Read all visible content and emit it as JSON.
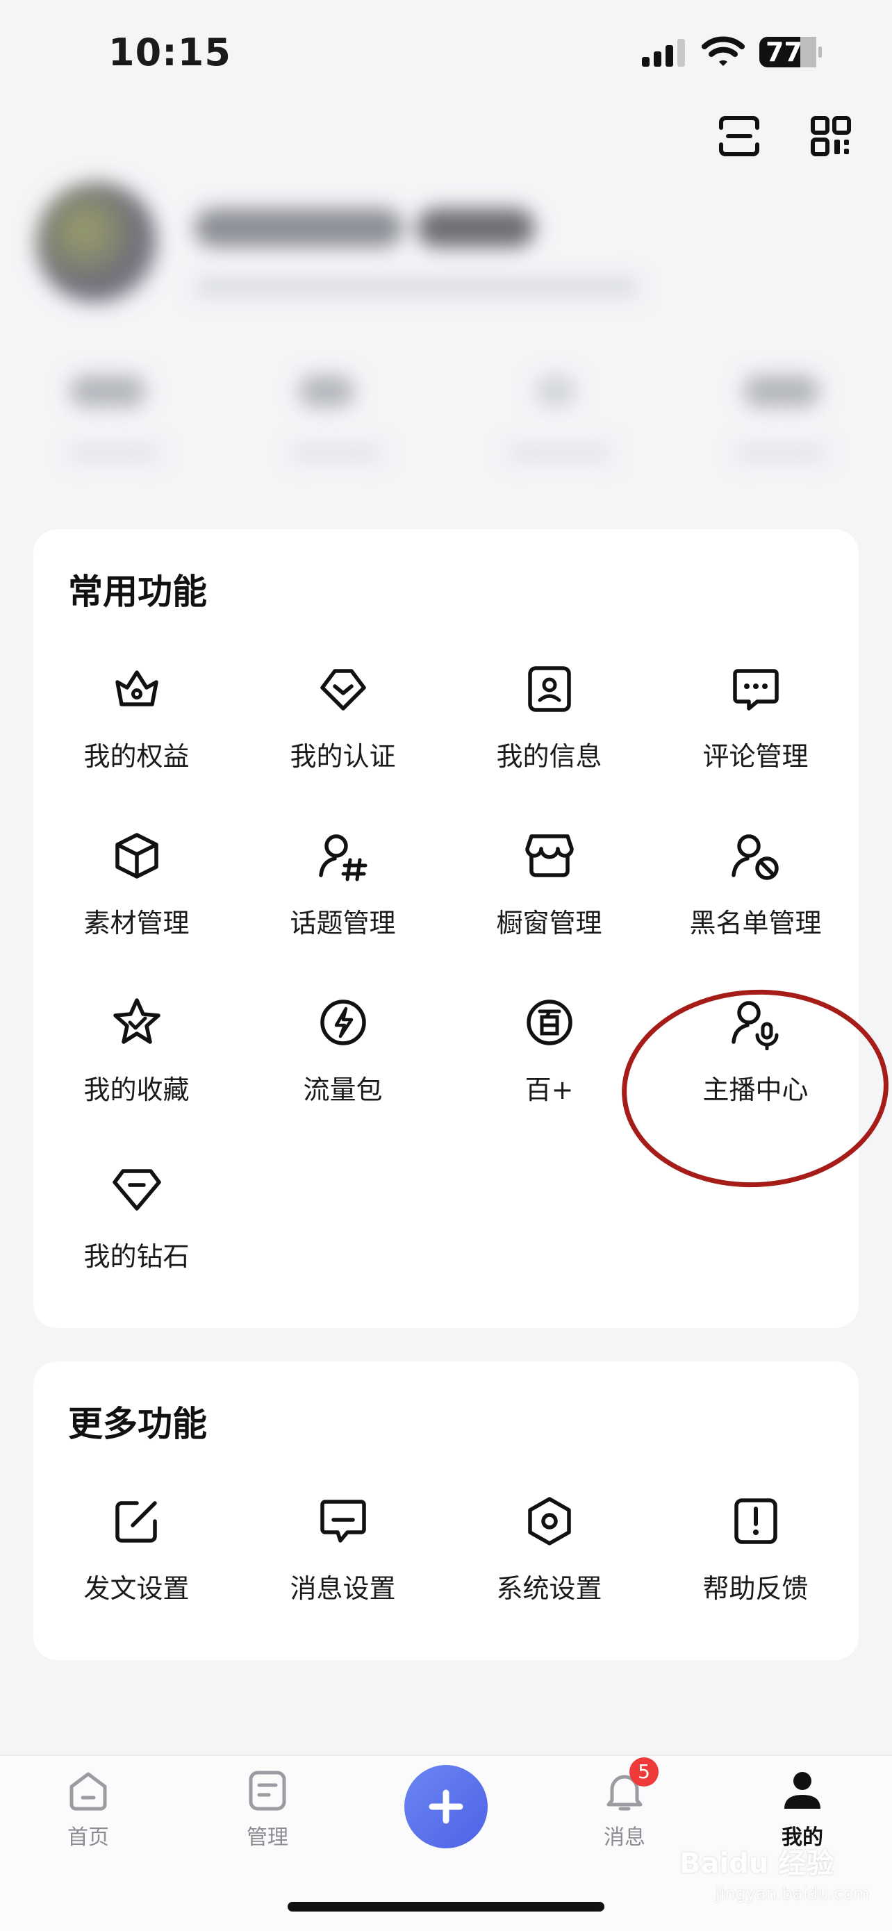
{
  "status_bar": {
    "time": "10:15",
    "battery": "77"
  },
  "common_functions": {
    "title": "常用功能",
    "items": [
      {
        "label": "我的权益",
        "icon": "crown-icon"
      },
      {
        "label": "我的认证",
        "icon": "verify-badge-icon"
      },
      {
        "label": "我的信息",
        "icon": "id-card-icon"
      },
      {
        "label": "评论管理",
        "icon": "comment-icon"
      },
      {
        "label": "素材管理",
        "icon": "cube-icon"
      },
      {
        "label": "话题管理",
        "icon": "user-hashtag-icon"
      },
      {
        "label": "橱窗管理",
        "icon": "storefront-icon"
      },
      {
        "label": "黑名单管理",
        "icon": "user-blocked-icon"
      },
      {
        "label": "我的收藏",
        "icon": "star-check-icon"
      },
      {
        "label": "流量包",
        "icon": "lightning-icon"
      },
      {
        "label": "百+",
        "icon": "bai-icon"
      },
      {
        "label": "主播中心",
        "icon": "user-microphone-icon"
      },
      {
        "label": "我的钻石",
        "icon": "diamond-icon"
      }
    ]
  },
  "more_functions": {
    "title": "更多功能",
    "items": [
      {
        "label": "发文设置",
        "icon": "edit-icon"
      },
      {
        "label": "消息设置",
        "icon": "message-icon"
      },
      {
        "label": "系统设置",
        "icon": "settings-hexagon-icon"
      },
      {
        "label": "帮助反馈",
        "icon": "help-exclamation-icon"
      }
    ]
  },
  "tab_bar": {
    "items": [
      {
        "label": "首页",
        "icon": "home-icon",
        "active": false
      },
      {
        "label": "管理",
        "icon": "manage-icon",
        "active": false
      },
      {
        "label": "",
        "icon": "plus-icon",
        "active": false
      },
      {
        "label": "消息",
        "icon": "bell-icon",
        "active": false
      },
      {
        "label": "我的",
        "icon": "profile-icon",
        "active": true
      }
    ],
    "message_badge": "5"
  },
  "watermark": {
    "text": "Baidu 经验",
    "url_text": "jingyan.baidu.com"
  },
  "colors": {
    "accent": "#5468e8",
    "badge": "#ef3a3a",
    "annotation": "#a51c18"
  }
}
